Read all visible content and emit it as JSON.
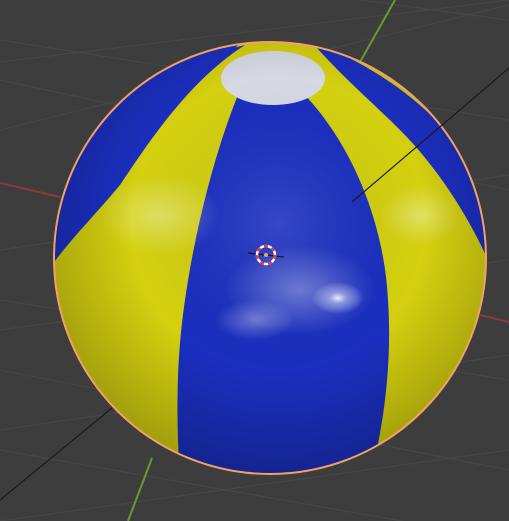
{
  "viewport": {
    "background": "#3d3d3d",
    "grid_color": "#474747",
    "x_axis_color": "#8b3a3f",
    "y_axis_color": "#6a9a2b",
    "selection_outline_color": "#f2a067"
  },
  "object": {
    "type": "beach-ball",
    "selected": true,
    "colors": {
      "yellow": "#d4d010",
      "blue": "#1b2fc0",
      "cap": "#d6d9e3"
    }
  },
  "cursor": {
    "icon": "3d-cursor-icon",
    "ring_colors": [
      "#e23a3a",
      "#ffffff"
    ]
  }
}
